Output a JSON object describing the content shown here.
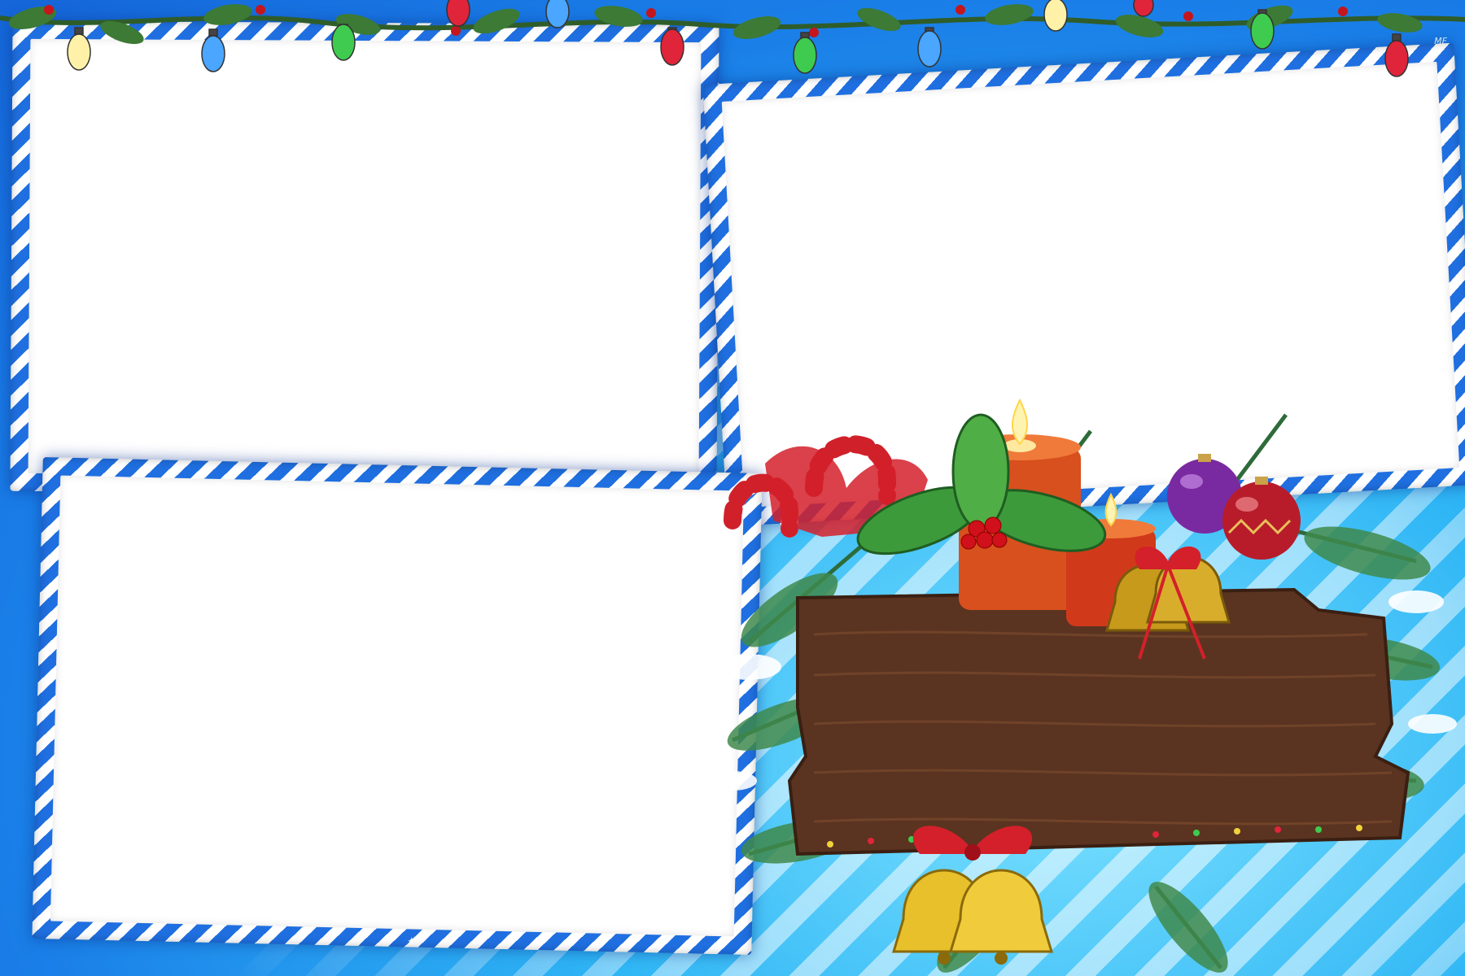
{
  "image": {
    "watermark": "MF",
    "colors": {
      "background": "#1a7fe8",
      "frame_stripe_blue": "#1f6fe0",
      "frame_stripe_white": "#ffffff",
      "wood": "#5a3420"
    },
    "photo_slots": [
      {
        "name": "photo-slot-top-left"
      },
      {
        "name": "photo-slot-top-right"
      },
      {
        "name": "photo-slot-bottom-left"
      }
    ],
    "decorations": [
      "string-lights",
      "candles",
      "candy-canes",
      "holly",
      "ornaments",
      "bells",
      "wooden-sign",
      "pine-branches"
    ]
  }
}
